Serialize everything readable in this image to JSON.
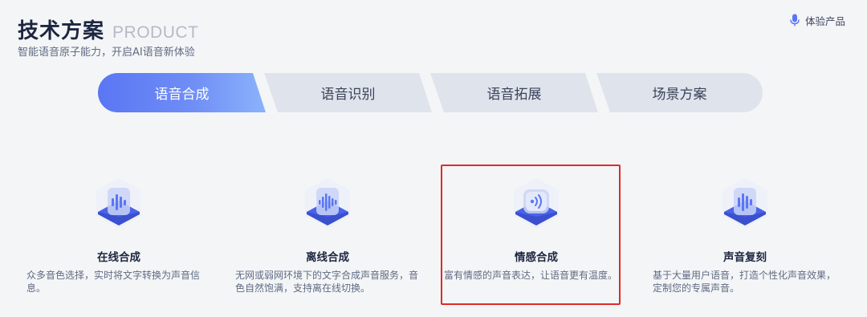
{
  "header": {
    "title": "技术方案",
    "title_en": "PRODUCT",
    "subtitle": "智能语音原子能力，开启AI语音新体验",
    "try_link": "体验产品"
  },
  "tabs": [
    {
      "label": "语音合成",
      "active": true
    },
    {
      "label": "语音识别",
      "active": false
    },
    {
      "label": "语音拓展",
      "active": false
    },
    {
      "label": "场景方案",
      "active": false
    }
  ],
  "cards": [
    {
      "title": "在线合成",
      "desc": "众多音色选择，实时将文字转换为声音信息。",
      "icon": "soundwave-icon"
    },
    {
      "title": "离线合成",
      "desc": "无网或弱网环境下的文字合成声音服务，音色自然饱满，支持离在线切换。",
      "icon": "offline-soundwave-icon"
    },
    {
      "title": "情感合成",
      "desc": "富有情感的声音表达，让语音更有温度。",
      "icon": "emotion-sound-icon"
    },
    {
      "title": "声音复刻",
      "desc": "基于大量用户语音，打造个性化声音效果，定制您的专属声音。",
      "icon": "voice-clone-icon"
    }
  ],
  "colors": {
    "accent": "#5a76f3",
    "accent_light": "#8ab3fb",
    "tab_inactive": "#dfe3ec",
    "highlight": "#e02a2a"
  }
}
